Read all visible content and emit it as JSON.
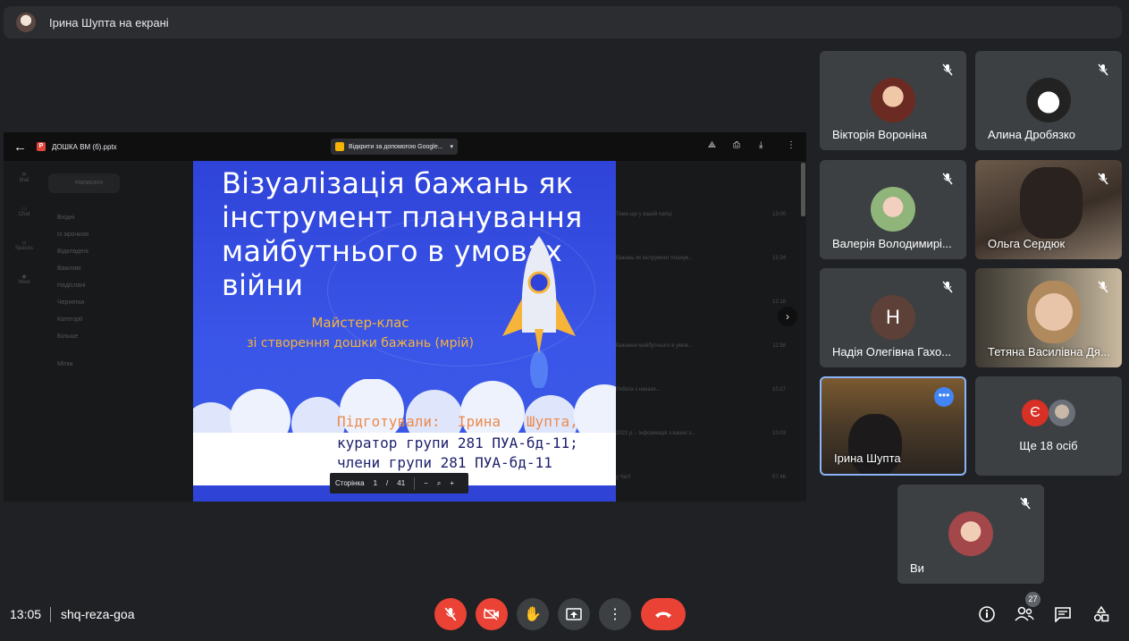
{
  "presenter": {
    "name_text": "Ірина Шупта на екрані"
  },
  "share": {
    "file_name": "ДОШКА ВМ (б).pptx",
    "open_with": "Відкрити за допомогою Google...",
    "slide": {
      "title": "Візуалізація бажань як інструмент планування майбутнього в умовах війни",
      "subtitle_line1": "Майстер-клас",
      "subtitle_line2": "зі створення дошки бажань (мрій)",
      "prepared_by": "Підготували:  Ірина   Шупта,",
      "curator": "куратор групи 281 ПУА-бд-11;",
      "members": "члени групи 281 ПУА-бд-11"
    },
    "pager": {
      "label": "Сторінка",
      "current": "1",
      "slash": "/",
      "total": "41"
    },
    "gmail_bg": {
      "compose": "Написати",
      "folders": [
        "Вхідні",
        "Із зірочкою",
        "Відкладені",
        "Важливі",
        "Надіслані",
        "Чернетки",
        "Категорії",
        "Більше"
      ],
      "labels": "Мітки",
      "rows": [
        {
          "t": "Тема ще у вашій папці",
          "time": "13:00"
        },
        {
          "t": "бажань як інструмент планув...",
          "time": "12:24"
        },
        {
          "t": "",
          "time": "12:18"
        },
        {
          "t": "бажання майбутнього в умов...",
          "time": "11:58"
        },
        {
          "t": "Робота з накази...",
          "time": "10:27"
        },
        {
          "t": "2022 р. - Інформація з вашої з...",
          "time": "10:03"
        },
        {
          "t": "у Чатї",
          "time": "07:46"
        },
        {
          "t": "Нове повідомлення",
          "time": ""
        }
      ]
    }
  },
  "participants": [
    {
      "name": "Вікторія Вороніна",
      "muted": true
    },
    {
      "name": "Алина Дробязко",
      "muted": true
    },
    {
      "name": "Валерія Володимирі...",
      "muted": true
    },
    {
      "name": "Ольга Сердюк",
      "muted": true
    },
    {
      "name": "Надія Олегівна Гахо...",
      "muted": true,
      "initial": "Н"
    },
    {
      "name": "Тетяна Василівна Дя...",
      "muted": true
    },
    {
      "name": "Ірина Шупта",
      "muted": false
    },
    {
      "name": "Ще 18 осіб",
      "initial": "Є"
    },
    {
      "name": "Ви",
      "muted": true
    }
  ],
  "bottom": {
    "time": "13:05",
    "meeting_code": "shq-reza-goa",
    "people_count": "27"
  },
  "colors": {
    "background": "#202124",
    "tile": "#3c4043",
    "danger": "#ea4335",
    "slide_blue": "#3a56e8",
    "accent_orange": "#f6b43b"
  },
  "icons": [
    "mic-off-icon",
    "camera-off-icon",
    "raise-hand-icon",
    "present-icon",
    "more-icon",
    "end-call-icon",
    "info-icon",
    "people-icon",
    "chat-icon",
    "activities-icon"
  ]
}
